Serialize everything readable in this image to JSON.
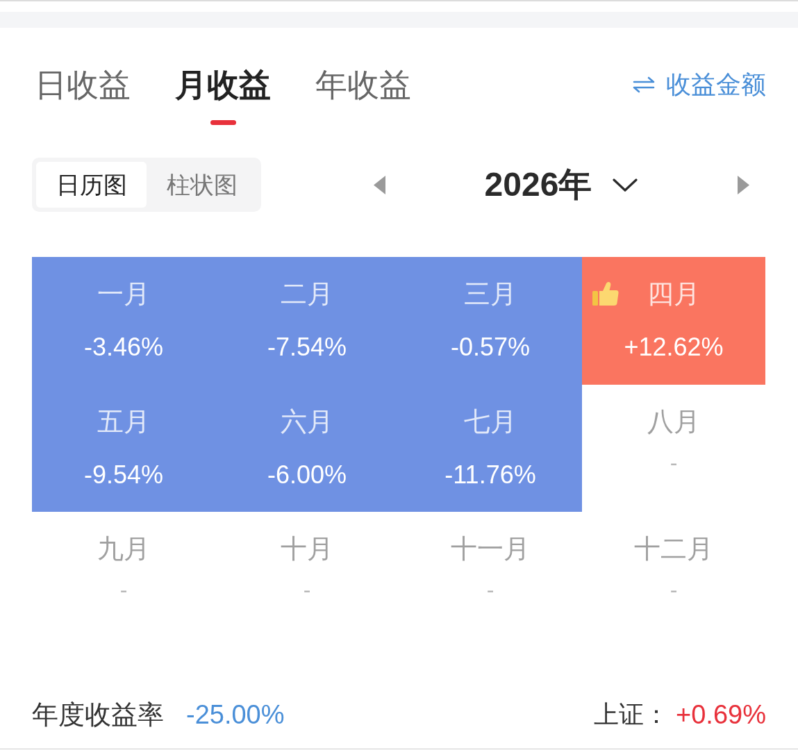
{
  "top_tabs": [
    {
      "label": "日收益",
      "selected": false
    },
    {
      "label": "月收益",
      "selected": true
    },
    {
      "label": "年收益",
      "selected": false
    }
  ],
  "amount_toggle": {
    "label": "收益金额"
  },
  "view_switch": [
    {
      "label": "日历图",
      "selected": true
    },
    {
      "label": "柱状图",
      "selected": false
    }
  ],
  "year_picker": {
    "label": "2026年"
  },
  "months": [
    {
      "name": "一月",
      "value": "-3.46%",
      "color": "#6f91e3",
      "best": false
    },
    {
      "name": "二月",
      "value": "-7.54%",
      "color": "#6f91e3",
      "best": false
    },
    {
      "name": "三月",
      "value": "-0.57%",
      "color": "#6f91e3",
      "best": false
    },
    {
      "name": "四月",
      "value": "+12.62%",
      "color": "#fa7560",
      "best": true
    },
    {
      "name": "五月",
      "value": "-9.54%",
      "color": "#6f91e3",
      "best": false
    },
    {
      "name": "六月",
      "value": "-6.00%",
      "color": "#6f91e3",
      "best": false
    },
    {
      "name": "七月",
      "value": "-11.76%",
      "color": "#6f91e3",
      "best": false
    },
    {
      "name": "八月",
      "value": "-",
      "best": false
    },
    {
      "name": "九月",
      "value": "-",
      "best": false
    },
    {
      "name": "十月",
      "value": "-",
      "best": false
    },
    {
      "name": "十一月",
      "value": "-",
      "best": false
    },
    {
      "name": "十二月",
      "value": "-",
      "best": false
    }
  ],
  "annual_return": {
    "label": "年度收益率",
    "value": "-25.00%"
  },
  "index_change": {
    "label": "上证：",
    "value": "+0.69%"
  }
}
